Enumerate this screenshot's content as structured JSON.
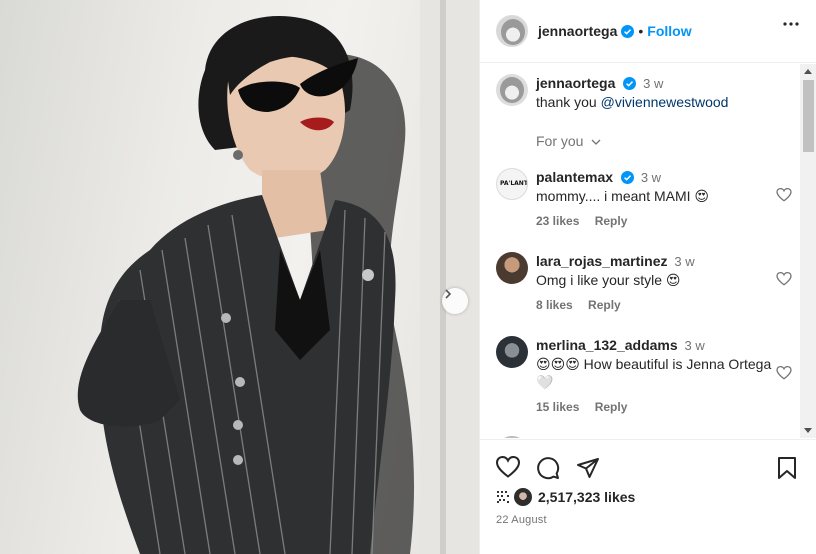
{
  "post": {
    "author": "jennaortega",
    "follow_label": "Follow",
    "separator": "•",
    "caption": {
      "user": "jennaortega",
      "time": "3 w",
      "text_prefix": "thank you ",
      "mention": "@viviennewestwood"
    },
    "for_you_label": "For you"
  },
  "comments": [
    {
      "user": "palantemax",
      "verified": true,
      "time": "3 w",
      "text": "mommy.... i meant MAMI 😍",
      "likes": "23 likes",
      "reply": "Reply"
    },
    {
      "user": "lara_rojas_martinez",
      "verified": false,
      "time": "3 w",
      "text": "Omg i like your style 😍",
      "likes": "8 likes",
      "reply": "Reply"
    },
    {
      "user": "merlina_132_addams",
      "verified": false,
      "time": "3 w",
      "text": "😍😍😍 How beautiful is Jenna Ortega 🤍",
      "likes": "15 likes",
      "reply": "Reply"
    }
  ],
  "stats": {
    "likes": "2,517,323 likes",
    "date": "22 August"
  },
  "colors": {
    "accent": "#0095f6",
    "verified": "#0095f6",
    "text": "#262626",
    "muted": "#737373"
  },
  "icons": [
    "verified-badge-icon",
    "more-options-icon",
    "heart-icon",
    "comment-icon",
    "share-icon",
    "bookmark-icon",
    "chevron-right-icon"
  ]
}
